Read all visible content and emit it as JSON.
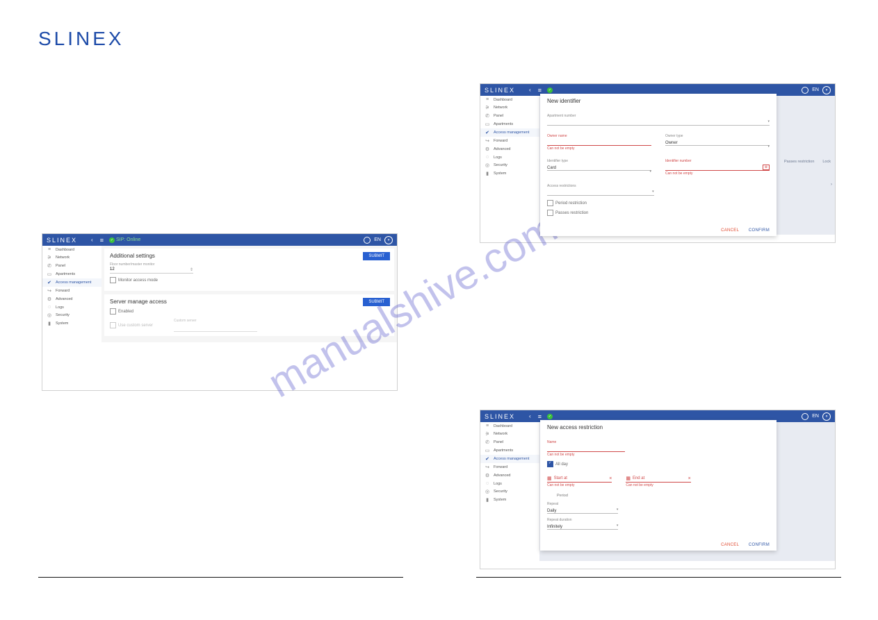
{
  "brand": "SLINEX",
  "lang": "EN",
  "watermark": "manualshive.com",
  "sidebar_items": [
    {
      "icon": "≡",
      "label": "Dashboard"
    },
    {
      "icon": "⚞",
      "label": "Network"
    },
    {
      "icon": "✆",
      "label": "Panel"
    },
    {
      "icon": "▭",
      "label": "Apartments"
    },
    {
      "icon": "✔",
      "label": "Access management"
    },
    {
      "icon": "↪",
      "label": "Forward"
    },
    {
      "icon": "⚙",
      "label": "Advanced"
    },
    {
      "icon": "◌",
      "label": "Logs"
    },
    {
      "icon": "◎",
      "label": "Security"
    },
    {
      "icon": "▮",
      "label": "System"
    }
  ],
  "status_text": "SIP: Online",
  "screenshot1": {
    "card1_title": "Additional settings",
    "submit": "SUBMIT",
    "floor_label": "Floor number/master monitor",
    "floor_value": "12",
    "monitor_check": "Monitor access mode",
    "card2_title": "Server manage access",
    "enabled": "Enabled",
    "use_custom": "Use custom server",
    "custom_server": "Custom server"
  },
  "screenshot2": {
    "modal_title": "New identifier",
    "apartment_label": "Apartment number",
    "owner_name_label": "Owner name",
    "owner_name_err": "Can not be empty",
    "owner_type_label": "Owner type",
    "owner_type_value": "Owner",
    "identifier_type_label": "Identifier type",
    "identifier_type_value": "Card",
    "identifier_number_label": "Identifier number",
    "identifier_number_err": "Can not be empty",
    "access_restriction_label": "Access restrictions",
    "period_restriction": "Period restriction",
    "passes_restriction": "Passes restriction",
    "cancel": "CANCEL",
    "confirm": "CONFIRM",
    "bg_col1": "Passes restriction",
    "bg_col2": "Lock"
  },
  "screenshot3": {
    "modal_title": "New access restriction",
    "name_label": "Name",
    "name_err": "Can not be empty",
    "all_day": "All day",
    "start_at": "Start at",
    "start_err": "Can not be empty",
    "end_at": "End at",
    "end_err": "Can not be empty",
    "period": "Period",
    "repeat_label": "Repeat",
    "repeat_value": "Daily",
    "repeat_duration_label": "Repeat duration",
    "repeat_duration_value": "Infinitely",
    "cancel": "CANCEL",
    "confirm": "CONFIRM"
  }
}
